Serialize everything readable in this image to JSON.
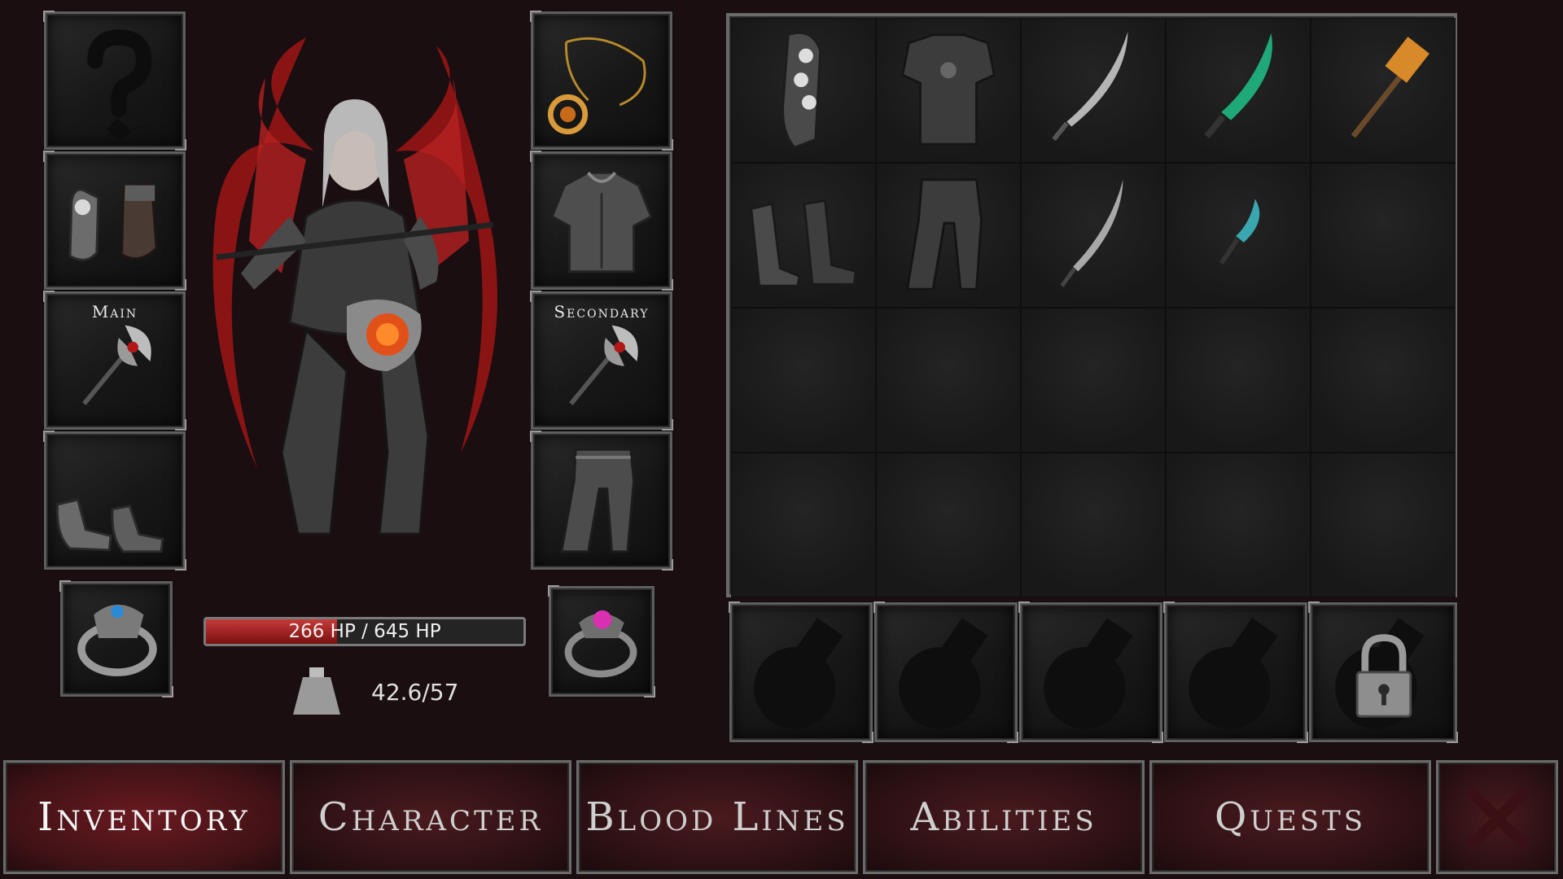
{
  "equipment": {
    "helmet": {
      "icon": "unknown-helmet-question-icon"
    },
    "gloves": {
      "icon": "gauntlets-icon"
    },
    "main_weapon": {
      "label": "Main",
      "icon": "war-axe-icon"
    },
    "boots": {
      "icon": "boots-icon"
    },
    "amulet": {
      "icon": "gold-amulet-icon"
    },
    "chest": {
      "icon": "chest-armor-icon"
    },
    "secondary_weapon": {
      "label": "Secondary",
      "icon": "war-axe-icon"
    },
    "legs": {
      "icon": "leg-armor-icon"
    },
    "ring_left": {
      "icon": "wolf-ring-blue-gem-icon"
    },
    "ring_right": {
      "icon": "ring-pink-gem-icon"
    }
  },
  "character": {
    "icon": "winged-armored-warrior-portrait"
  },
  "stats": {
    "hp_text": "266 HP / 645 HP",
    "hp_current": 266,
    "hp_max": 645,
    "weight_text": "42.6/57"
  },
  "inventory": {
    "rows": 4,
    "cols": 5,
    "items": [
      {
        "row": 0,
        "col": 0,
        "icon": "skull-gauntlet-icon"
      },
      {
        "row": 0,
        "col": 1,
        "icon": "dark-chest-armor-icon"
      },
      {
        "row": 0,
        "col": 2,
        "icon": "curved-sword-icon"
      },
      {
        "row": 0,
        "col": 3,
        "icon": "green-blade-sword-icon"
      },
      {
        "row": 0,
        "col": 4,
        "icon": "golden-warhammer-icon"
      },
      {
        "row": 1,
        "col": 0,
        "icon": "dark-boots-icon"
      },
      {
        "row": 1,
        "col": 1,
        "icon": "dark-leg-armor-icon"
      },
      {
        "row": 1,
        "col": 2,
        "icon": "katana-icon"
      },
      {
        "row": 1,
        "col": 3,
        "icon": "teal-dagger-icon"
      }
    ]
  },
  "potion_slots": [
    {
      "icon": "empty-potion-slot-icon"
    },
    {
      "icon": "empty-potion-slot-icon"
    },
    {
      "icon": "empty-potion-slot-icon"
    },
    {
      "icon": "empty-potion-slot-icon"
    },
    {
      "icon": "padlock-icon"
    }
  ],
  "tabs": [
    {
      "label": "Inventory",
      "active": true
    },
    {
      "label": "Character",
      "active": false
    },
    {
      "label": "Blood Lines",
      "active": false
    },
    {
      "label": "Abilities",
      "active": false
    },
    {
      "label": "Quests",
      "active": false
    }
  ],
  "close_icon": "close-x-icon",
  "colors": {
    "background": "#1a0e11",
    "hp_fill": "#b02a2a",
    "tab_active": "#6a1a20"
  }
}
